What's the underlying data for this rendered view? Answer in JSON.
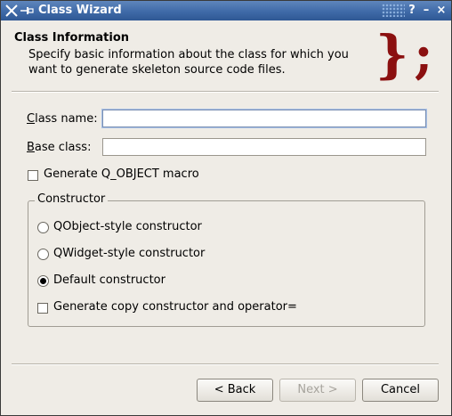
{
  "window": {
    "title": "Class Wizard"
  },
  "titlebar_buttons": {
    "help": "?",
    "minimize": "–",
    "close": "×"
  },
  "header": {
    "title": "Class Information",
    "description": "Specify basic information about the class for which you want to generate skeleton source code files.",
    "logo_text": "};"
  },
  "form": {
    "class_name": {
      "label": "Class name:",
      "value": ""
    },
    "base_class": {
      "label": "Base class:",
      "value": ""
    },
    "q_object": {
      "label": "Generate Q_OBJECT macro",
      "checked": false
    }
  },
  "constructor": {
    "title": "Constructor",
    "options": [
      {
        "label": "QObject-style constructor",
        "selected": false
      },
      {
        "label": "QWidget-style constructor",
        "selected": false
      },
      {
        "label": "Default constructor",
        "selected": true
      }
    ],
    "copy": {
      "label": "Generate copy constructor and operator=",
      "checked": false
    }
  },
  "buttons": {
    "back": "< Back",
    "next": "Next >",
    "cancel": "Cancel"
  },
  "colors": {
    "titlebar": "#3f6aa8",
    "logo": "#8b1010"
  }
}
